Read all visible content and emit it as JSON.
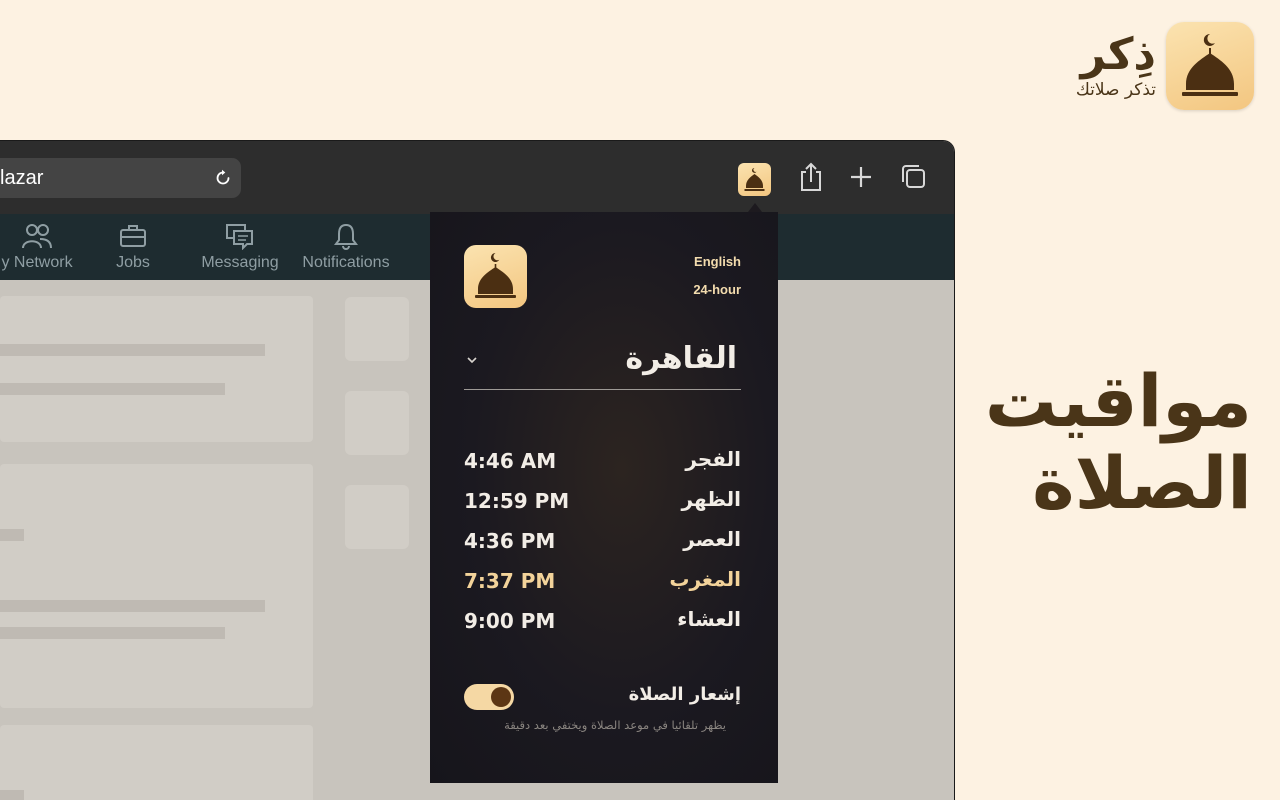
{
  "brand": {
    "name": "ذِكر",
    "tagline": "تذكر صلاتك",
    "icon": "mosque-dome-icon"
  },
  "headline": {
    "line1": "مواقيت",
    "line2": "الصلاة"
  },
  "browser": {
    "url_text": "lazar",
    "toolbar_icons": [
      "reload-icon",
      "extension-mosque-icon",
      "share-icon",
      "new-tab-plus-icon",
      "tabs-overview-icon"
    ],
    "nav": [
      {
        "label": "y Network",
        "icon": "people-icon"
      },
      {
        "label": "Jobs",
        "icon": "briefcase-icon"
      },
      {
        "label": "Messaging",
        "icon": "messages-icon"
      },
      {
        "label": "Notifications",
        "icon": "bell-icon"
      }
    ]
  },
  "popup": {
    "language_option": "English",
    "clock_option": "24-hour",
    "city": "القاهرة",
    "prayers": [
      {
        "name": "الفجر",
        "time": "4:46 AM",
        "active": false
      },
      {
        "name": "الظهر",
        "time": "12:59 PM",
        "active": false
      },
      {
        "name": "العصر",
        "time": "4:36 PM",
        "active": false
      },
      {
        "name": "المغرب",
        "time": "7:37 PM",
        "active": true
      },
      {
        "name": "العشاء",
        "time": "9:00 PM",
        "active": false
      }
    ],
    "notification_label": "إشعار الصلاة",
    "notification_enabled": true,
    "notification_hint": "يظهر تلقائيا في موعد الصلاة ويختفي بعد دقيقة"
  },
  "colors": {
    "background": "#fdf2e2",
    "brand_brown": "#4a3518",
    "icon_gold": "#f3c680",
    "popup_bg": "#1b1920",
    "active_prayer": "#f3d39a"
  }
}
